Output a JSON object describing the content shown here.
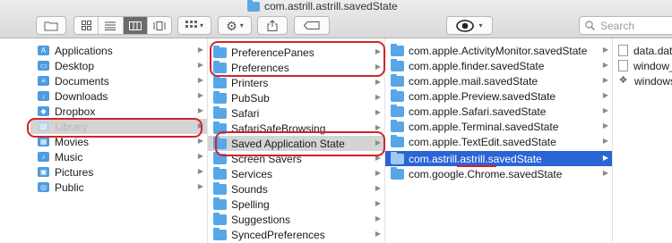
{
  "window": {
    "title": "com.astrill.astrill.savedState"
  },
  "search": {
    "placeholder": "Search"
  },
  "sidebar": {
    "items": [
      {
        "label": "Applications",
        "icon": "applications-icon"
      },
      {
        "label": "Desktop",
        "icon": "desktop-icon"
      },
      {
        "label": "Documents",
        "icon": "documents-icon"
      },
      {
        "label": "Downloads",
        "icon": "downloads-icon"
      },
      {
        "label": "Dropbox",
        "icon": "dropbox-icon"
      },
      {
        "label": "Library",
        "icon": "library-icon"
      },
      {
        "label": "Movies",
        "icon": "movies-icon"
      },
      {
        "label": "Music",
        "icon": "music-icon"
      },
      {
        "label": "Pictures",
        "icon": "pictures-icon"
      },
      {
        "label": "Public",
        "icon": "public-icon"
      }
    ]
  },
  "library_column": {
    "items": [
      "PreferencePanes",
      "Preferences",
      "Printers",
      "PubSub",
      "Safari",
      "SafariSafeBrowsing",
      "Saved Application State",
      "Screen Savers",
      "Services",
      "Sounds",
      "Spelling",
      "Suggestions",
      "SyncedPreferences"
    ],
    "selected": "Saved Application State"
  },
  "saved_state_column": {
    "items": [
      "com.apple.ActivityMonitor.savedState",
      "com.apple.finder.savedState",
      "com.apple.mail.savedState",
      "com.apple.Preview.savedState",
      "com.apple.Safari.savedState",
      "com.apple.Terminal.savedState",
      "com.apple.TextEdit.savedState",
      "com.astrill.astrill.savedState",
      "com.google.Chrome.savedState"
    ],
    "selected": "com.astrill.astrill.savedState"
  },
  "files_column": {
    "items": [
      "data.dat",
      "window_",
      "windows"
    ]
  },
  "colors": {
    "selection": "#2a64d5",
    "annotation": "#d2232a",
    "folder": "#57a7e8"
  }
}
